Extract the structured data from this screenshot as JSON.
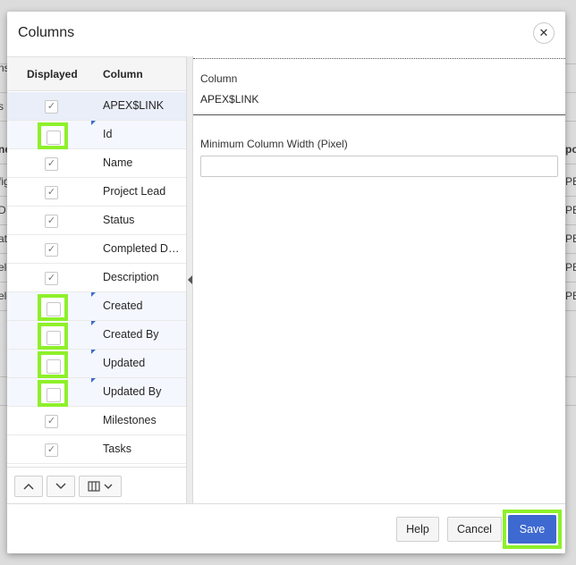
{
  "background": {
    "rows_left": [
      "ns",
      "s",
      "ne",
      "fig",
      "D",
      "at",
      "elo",
      "elo"
    ],
    "rows_right": [
      "po",
      "PE",
      "PE",
      "PE",
      "PE",
      "PE"
    ]
  },
  "dialog": {
    "title": "Columns",
    "close_label": "✕"
  },
  "columns_table": {
    "header_displayed": "Displayed",
    "header_column": "Column",
    "rows": [
      {
        "name": "APEX$LINK",
        "checked": true,
        "selected": true,
        "modified": false
      },
      {
        "name": "Id",
        "checked": false,
        "selected": false,
        "modified": true
      },
      {
        "name": "Name",
        "checked": true,
        "selected": false,
        "modified": false
      },
      {
        "name": "Project Lead",
        "checked": true,
        "selected": false,
        "modified": false
      },
      {
        "name": "Status",
        "checked": true,
        "selected": false,
        "modified": false
      },
      {
        "name": "Completed Date",
        "checked": true,
        "selected": false,
        "modified": false
      },
      {
        "name": "Description",
        "checked": true,
        "selected": false,
        "modified": false
      },
      {
        "name": "Created",
        "checked": false,
        "selected": false,
        "modified": true
      },
      {
        "name": "Created By",
        "checked": false,
        "selected": false,
        "modified": true
      },
      {
        "name": "Updated",
        "checked": false,
        "selected": false,
        "modified": true
      },
      {
        "name": "Updated By",
        "checked": false,
        "selected": false,
        "modified": true
      },
      {
        "name": "Milestones",
        "checked": true,
        "selected": false,
        "modified": false
      },
      {
        "name": "Tasks",
        "checked": true,
        "selected": false,
        "modified": false
      }
    ],
    "check_glyph": "✓"
  },
  "toolbar": {
    "move_up_icon": "⌃",
    "move_down_icon": "⌄",
    "columns_menu_icon": "▥",
    "chevron": "⌄"
  },
  "detail": {
    "column_label": "Column",
    "column_value": "APEX$LINK",
    "min_width_label": "Minimum Column Width (Pixel)",
    "min_width_value": ""
  },
  "footer": {
    "help_label": "Help",
    "cancel_label": "Cancel",
    "save_label": "Save"
  },
  "colors": {
    "accent": "#3e69d0",
    "highlight": "#8ef02a",
    "selected_row": "#e9eef9"
  }
}
